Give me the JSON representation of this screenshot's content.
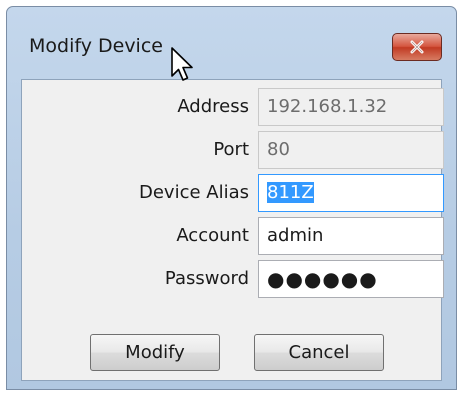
{
  "window": {
    "title": "Modify Device"
  },
  "form": {
    "address": {
      "label": "Address",
      "value": "192.168.1.32"
    },
    "port": {
      "label": "Port",
      "value": "80"
    },
    "device_alias": {
      "label": "Device Alias",
      "value": "811Z"
    },
    "account": {
      "label": "Account",
      "value": "admin"
    },
    "password": {
      "label": "Password",
      "value": "●●●●●●"
    }
  },
  "buttons": {
    "modify": "Modify",
    "cancel": "Cancel"
  },
  "icons": {
    "close": "close-icon",
    "cursor": "mouse-pointer-icon"
  },
  "colors": {
    "title_bar": "#b9cfe6",
    "close_button": "#c94a32",
    "selection": "#3399ff"
  }
}
